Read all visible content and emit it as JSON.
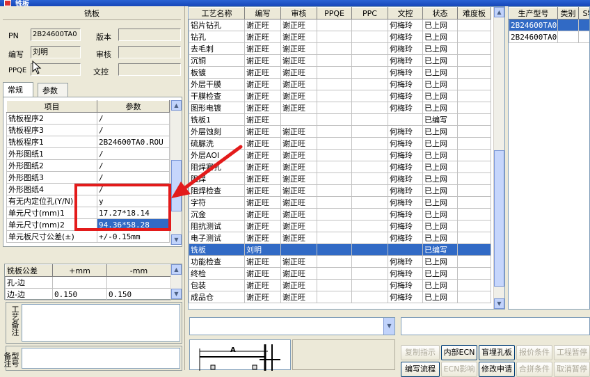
{
  "window": {
    "title": "铣板"
  },
  "left": {
    "group_title": "铣板",
    "fields": [
      {
        "label": "PN",
        "value": "2B24600TA0"
      },
      {
        "label": "版本",
        "value": ""
      },
      {
        "label": "编写",
        "value": "刘明"
      },
      {
        "label": "审核",
        "value": ""
      },
      {
        "label": "PPQE",
        "value": ""
      },
      {
        "label": "文控",
        "value": ""
      }
    ],
    "tabs": [
      "常规",
      "参数"
    ],
    "param_headers": [
      "项目",
      "参数"
    ],
    "param_rows": [
      [
        "铣板程序2",
        "/"
      ],
      [
        "铣板程序3",
        "/"
      ],
      [
        "铣板程序1",
        "2B24600TA0.ROU"
      ],
      [
        "外形图纸1",
        "/"
      ],
      [
        "外形图纸2",
        "/"
      ],
      [
        "外形图纸3",
        "/"
      ],
      [
        "外形图纸4",
        "/"
      ],
      [
        "有无内定位孔(Y/N)",
        "y"
      ],
      [
        "单元尺寸(mm)1",
        "17.27*18.14"
      ],
      [
        "单元尺寸(mm)2",
        "94.36*58.28"
      ],
      [
        "单元板尺寸公差(±)",
        "+/-0.15mm"
      ]
    ],
    "tol_headers": [
      "铣板公差",
      "+mm",
      "-mm"
    ],
    "tol_rows": [
      [
        "孔-边",
        "",
        ""
      ],
      [
        "边-边",
        "0.150",
        "0.150"
      ]
    ],
    "note1_label": "工艺备注",
    "note2_label": "型号备注"
  },
  "center": {
    "headers": [
      "工艺名称",
      "编写",
      "审核",
      "PPQE",
      "PPC",
      "文控",
      "状态",
      "难度板"
    ],
    "rows": [
      [
        "铝片钻孔",
        "谢正旺",
        "谢正旺",
        "",
        "",
        "何梅玲",
        "已上网",
        ""
      ],
      [
        "钻孔",
        "谢正旺",
        "谢正旺",
        "",
        "",
        "何梅玲",
        "已上网",
        ""
      ],
      [
        "去毛刺",
        "谢正旺",
        "谢正旺",
        "",
        "",
        "何梅玲",
        "已上网",
        ""
      ],
      [
        "沉铜",
        "谢正旺",
        "谢正旺",
        "",
        "",
        "何梅玲",
        "已上网",
        ""
      ],
      [
        "板镀",
        "谢正旺",
        "谢正旺",
        "",
        "",
        "何梅玲",
        "已上网",
        ""
      ],
      [
        "外层干膜",
        "谢正旺",
        "谢正旺",
        "",
        "",
        "何梅玲",
        "已上网",
        ""
      ],
      [
        "干膜检查",
        "谢正旺",
        "谢正旺",
        "",
        "",
        "何梅玲",
        "已上网",
        ""
      ],
      [
        "图形电镀",
        "谢正旺",
        "谢正旺",
        "",
        "",
        "何梅玲",
        "已上网",
        ""
      ],
      [
        "铣板1",
        "谢正旺",
        "",
        "",
        "",
        "",
        "已编写",
        ""
      ],
      [
        "外层蚀刻",
        "谢正旺",
        "谢正旺",
        "",
        "",
        "何梅玲",
        "已上网",
        ""
      ],
      [
        "硫脲洗",
        "谢正旺",
        "谢正旺",
        "",
        "",
        "何梅玲",
        "已上网",
        ""
      ],
      [
        "外层AOI",
        "谢正旺",
        "谢正旺",
        "",
        "",
        "何梅玲",
        "已上网",
        ""
      ],
      [
        "阻焊塞孔",
        "谢正旺",
        "谢正旺",
        "",
        "",
        "何梅玲",
        "已上网",
        ""
      ],
      [
        "阻焊",
        "谢正旺",
        "谢正旺",
        "",
        "",
        "何梅玲",
        "已上网",
        ""
      ],
      [
        "阻焊检查",
        "谢正旺",
        "谢正旺",
        "",
        "",
        "何梅玲",
        "已上网",
        ""
      ],
      [
        "字符",
        "谢正旺",
        "谢正旺",
        "",
        "",
        "何梅玲",
        "已上网",
        ""
      ],
      [
        "沉金",
        "谢正旺",
        "谢正旺",
        "",
        "",
        "何梅玲",
        "已上网",
        ""
      ],
      [
        "阻抗测试",
        "谢正旺",
        "谢正旺",
        "",
        "",
        "何梅玲",
        "已上网",
        ""
      ],
      [
        "电子测试",
        "谢正旺",
        "谢正旺",
        "",
        "",
        "何梅玲",
        "已上网",
        ""
      ],
      [
        "铣板",
        "刘明",
        "",
        "",
        "",
        "",
        "已编写",
        ""
      ],
      [
        "功能检查",
        "谢正旺",
        "谢正旺",
        "",
        "",
        "何梅玲",
        "已上网",
        ""
      ],
      [
        "终检",
        "谢正旺",
        "谢正旺",
        "",
        "",
        "何梅玲",
        "已上网",
        ""
      ],
      [
        "包装",
        "谢正旺",
        "谢正旺",
        "",
        "",
        "何梅玲",
        "已上网",
        ""
      ],
      [
        "成品仓",
        "谢正旺",
        "谢正旺",
        "",
        "",
        "何梅玲",
        "已上网",
        ""
      ]
    ],
    "selected_row": 19
  },
  "right": {
    "headers": [
      "生产型号",
      "类别",
      "S特"
    ],
    "rows": [
      [
        "2B24600TA0",
        "",
        ""
      ],
      [
        "2B24600TA0",
        "",
        ""
      ]
    ]
  },
  "bottom": {
    "diagram_label": "A",
    "buttons_row1": [
      "复制指示",
      "内部ECN",
      "盲埋孔板",
      "报价条件",
      "工程暂停"
    ],
    "buttons_row2": [
      "编写流程",
      "ECN影响",
      "修改申请",
      "合拼条件",
      "取消暂停"
    ]
  },
  "colors": {
    "selection": "#316ac5",
    "annotation": "#e31b1b"
  }
}
